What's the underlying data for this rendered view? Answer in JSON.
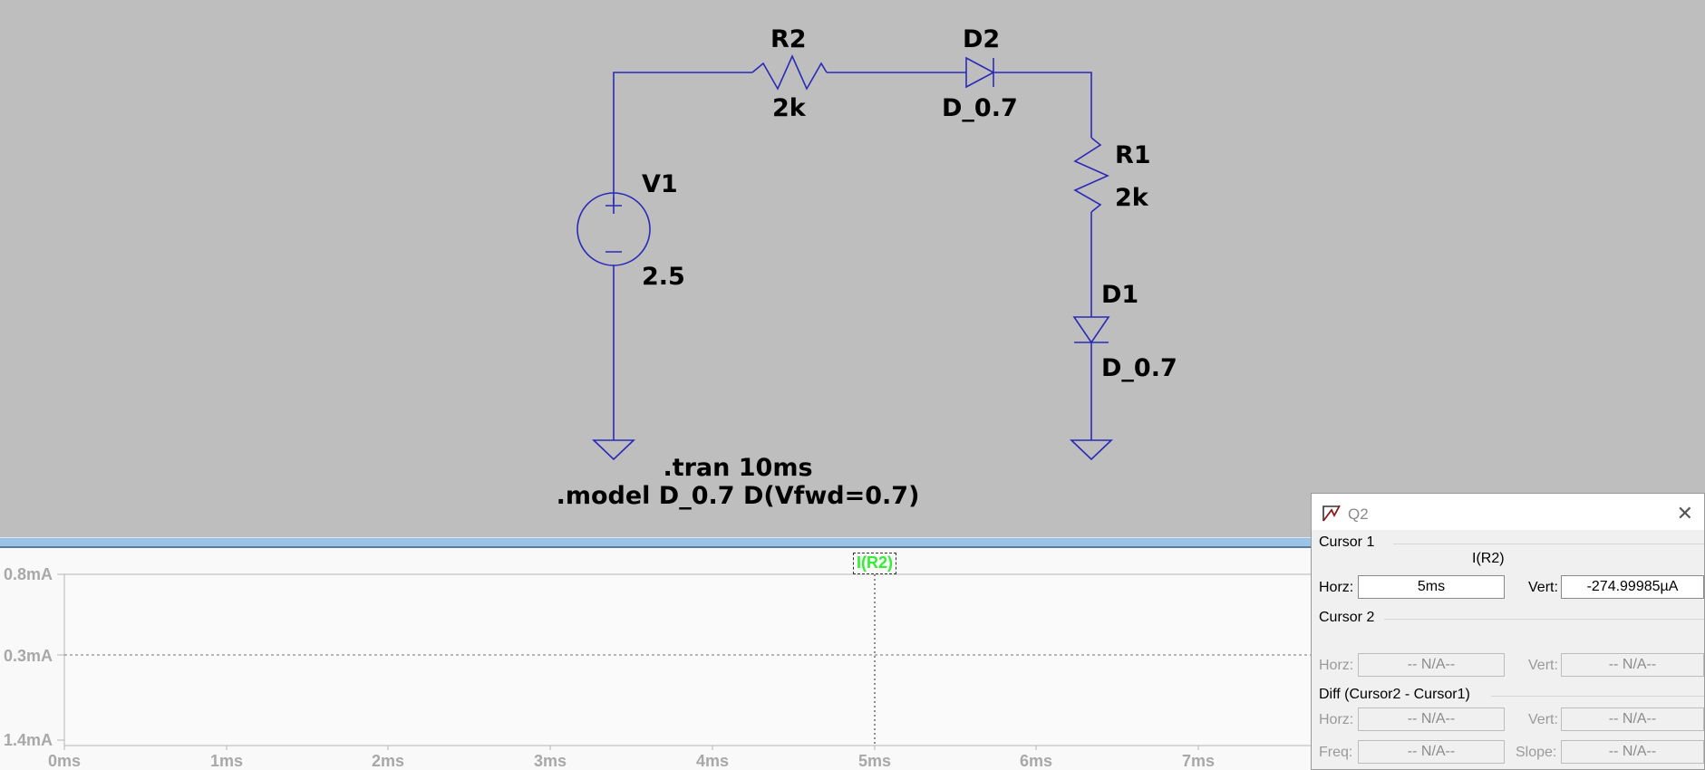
{
  "schematic": {
    "components": {
      "r2": {
        "name": "R2",
        "value": "2k"
      },
      "d2": {
        "name": "D2",
        "value": "D_0.7"
      },
      "r1": {
        "name": "R1",
        "value": "2k"
      },
      "d1": {
        "name": "D1",
        "value": "D_0.7"
      },
      "v1": {
        "name": "V1",
        "value": "2.5"
      }
    },
    "directives": {
      "tran": ".tran 10ms",
      "model": ".model D_0.7 D(Vfwd=0.7)"
    },
    "colors": {
      "wire": "#2a2ab8",
      "background": "#bebebe"
    }
  },
  "plot": {
    "trace_label": "I(R2)",
    "trace_color": "#33ee33",
    "y_ticks": [
      "0.8mA",
      "0.3mA",
      "1.4mA"
    ],
    "x_ticks": [
      "0ms",
      "1ms",
      "2ms",
      "3ms",
      "4ms",
      "5ms",
      "6ms",
      "7ms"
    ]
  },
  "cursor_window": {
    "title": "Q2",
    "icon": "cursor-app-icon",
    "cursor1": {
      "label": "Cursor 1",
      "trace": "I(R2)",
      "horz_label": "Horz:",
      "horz": "5ms",
      "vert_label": "Vert:",
      "vert": "-274.99985µA"
    },
    "cursor2": {
      "label": "Cursor 2",
      "horz_label": "Horz:",
      "horz": "-- N/A--",
      "vert_label": "Vert:",
      "vert": "-- N/A--"
    },
    "diff": {
      "label": "Diff (Cursor2 - Cursor1)",
      "horz_label": "Horz:",
      "horz": "-- N/A--",
      "vert_label": "Vert:",
      "vert": "-- N/A--",
      "freq_label": "Freq:",
      "freq": "-- N/A--",
      "slope_label": "Slope:",
      "slope": "-- N/A--"
    }
  }
}
